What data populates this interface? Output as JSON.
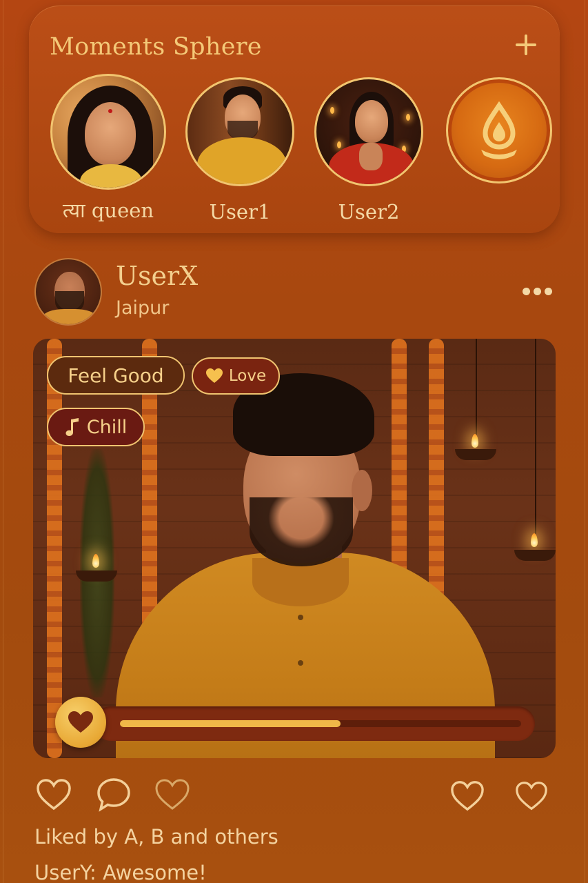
{
  "moments": {
    "title": "Moments Sphere",
    "add_icon": "plus-icon",
    "stories": [
      {
        "label": "त्या queen"
      },
      {
        "label": "User1"
      },
      {
        "label": "User2"
      }
    ],
    "extra_story_icon": "diya-icon"
  },
  "post": {
    "username": "UserX",
    "location": "Jaipur",
    "menu_icon": "more-dots-icon",
    "mood_tags": [
      {
        "label": "Feel Good"
      },
      {
        "label": "Love",
        "icon": "heart-icon"
      },
      {
        "label": "Chill",
        "icon": "music-note-icon"
      }
    ],
    "reaction_slider": {
      "icon": "heart-icon",
      "value": 0.55
    },
    "actions": [
      "like-icon",
      "comment-icon",
      "heart-outline-icon",
      "heart-icon",
      "heart-icon"
    ],
    "liked_by": "Liked by A, B and others",
    "comment": "UserY: Awesome!"
  },
  "colors": {
    "background": "#a9480f",
    "accent_gold": "#f4c978",
    "text_cream": "#f4d9a6"
  }
}
